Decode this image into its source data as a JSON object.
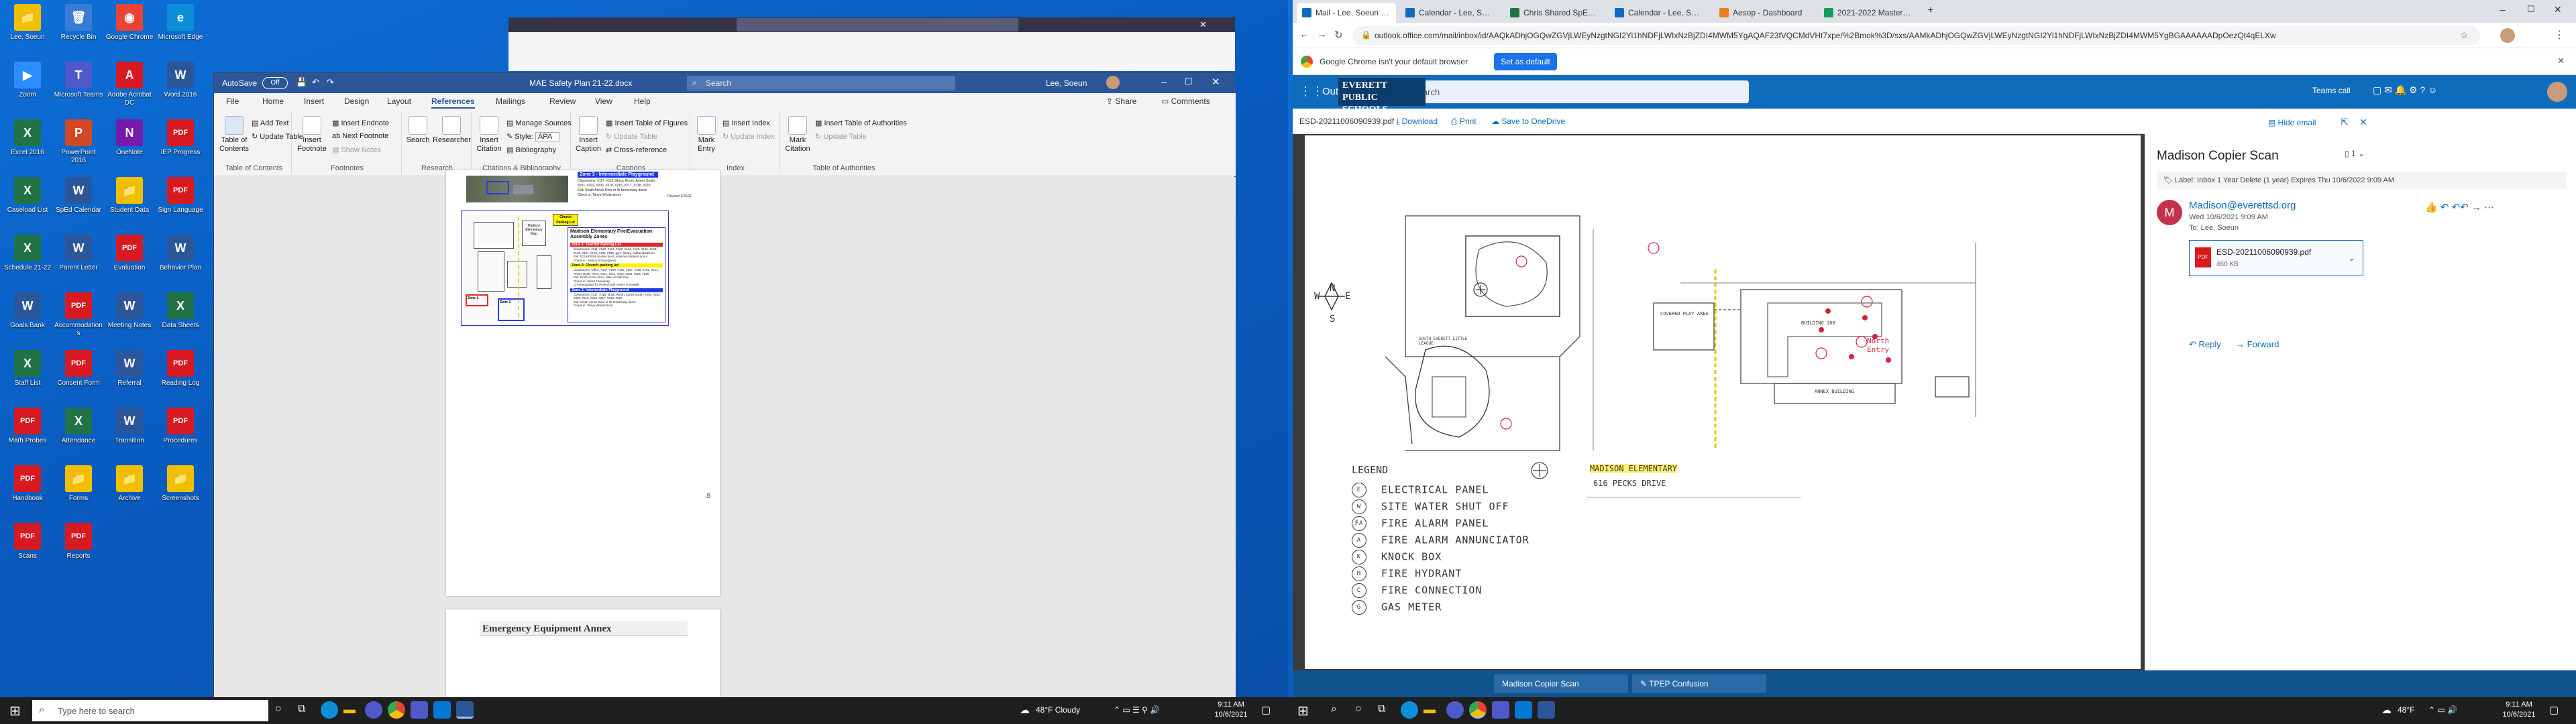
{
  "desktop_left": {
    "icons": [
      {
        "label": "Lee, Soeun",
        "color": "#f0c000",
        "glyph": "📁"
      },
      {
        "label": "Recycle Bin",
        "color": "#3a7bd5",
        "glyph": "🗑"
      },
      {
        "label": "Google Chrome",
        "color": "#ea4335",
        "glyph": "◉"
      },
      {
        "label": "Microsoft Edge",
        "color": "#0c8ed9",
        "glyph": "e"
      },
      {
        "label": "Zoom",
        "color": "#2d8cff",
        "glyph": "▶"
      },
      {
        "label": "Microsoft Teams",
        "color": "#5059c9",
        "glyph": "T"
      },
      {
        "label": "Adobe Acrobat DC",
        "color": "#d71920",
        "glyph": "A"
      },
      {
        "label": "Word 2016",
        "color": "#2b579a",
        "glyph": "W"
      },
      {
        "label": "Excel 2016",
        "color": "#217346",
        "glyph": "X"
      },
      {
        "label": "PowerPoint 2016",
        "color": "#d24726",
        "glyph": "P"
      },
      {
        "label": "OneNote",
        "color": "#7719aa",
        "glyph": "N"
      },
      {
        "label": "IEP Progress",
        "color": "#d71920",
        "glyph": "PDF"
      },
      {
        "label": "Caseload List",
        "color": "#217346",
        "glyph": "X"
      },
      {
        "label": "SpEd Calendar",
        "color": "#2b579a",
        "glyph": "W"
      },
      {
        "label": "Student Data",
        "color": "#f0c000",
        "glyph": "📁"
      },
      {
        "label": "Sign Language",
        "color": "#d71920",
        "glyph": "PDF"
      },
      {
        "label": "Schedule 21-22",
        "color": "#217346",
        "glyph": "X"
      },
      {
        "label": "Parent Letter",
        "color": "#2b579a",
        "glyph": "W"
      },
      {
        "label": "Evaluation",
        "color": "#d71920",
        "glyph": "PDF"
      },
      {
        "label": "Behavior Plan",
        "color": "#2b579a",
        "glyph": "W"
      },
      {
        "label": "Goals Bank",
        "color": "#2b579a",
        "glyph": "W"
      },
      {
        "label": "Accommodations",
        "color": "#d71920",
        "glyph": "PDF"
      },
      {
        "label": "Meeting Notes",
        "color": "#2b579a",
        "glyph": "W"
      },
      {
        "label": "Data Sheets",
        "color": "#217346",
        "glyph": "X"
      },
      {
        "label": "Staff List",
        "color": "#217346",
        "glyph": "X"
      },
      {
        "label": "Consent Form",
        "color": "#d71920",
        "glyph": "PDF"
      },
      {
        "label": "Referral",
        "color": "#2b579a",
        "glyph": "W"
      },
      {
        "label": "Reading Log",
        "color": "#d71920",
        "glyph": "PDF"
      },
      {
        "label": "Math Probes",
        "color": "#d71920",
        "glyph": "PDF"
      },
      {
        "label": "Attendance",
        "color": "#217346",
        "glyph": "X"
      },
      {
        "label": "Transition",
        "color": "#2b579a",
        "glyph": "W"
      },
      {
        "label": "Procedures",
        "color": "#d71920",
        "glyph": "PDF"
      },
      {
        "label": "Handbook",
        "color": "#d71920",
        "glyph": "PDF"
      },
      {
        "label": "Forms",
        "color": "#f0c000",
        "glyph": "📁"
      },
      {
        "label": "Archive",
        "color": "#f0c000",
        "glyph": "📁"
      },
      {
        "label": "Screenshots",
        "color": "#f0c000",
        "glyph": "📁"
      },
      {
        "label": "Scans",
        "color": "#d71920",
        "glyph": "PDF"
      },
      {
        "label": "Reports",
        "color": "#d71920",
        "glyph": "PDF"
      }
    ]
  },
  "word": {
    "autosave_label": "AutoSave",
    "autosave_state": "Off",
    "title": "MAE Safety Plan 21-22.docx",
    "search_placeholder": "Search",
    "user": "Lee, Soeun",
    "menu": [
      "File",
      "Home",
      "Insert",
      "Design",
      "Layout",
      "References",
      "Mailings",
      "Review",
      "View",
      "Help"
    ],
    "share_label": "Share",
    "comments_label": "Comments",
    "ribbon": {
      "toc_label": "Table of Contents",
      "add_text": "Add Text",
      "update_table": "Update Table",
      "group_toc": "Table of Contents",
      "insert_footnote": "Insert Footnote",
      "insert_endnote": "Insert Endnote",
      "next_footnote": "Next Footnote",
      "show_notes": "Show Notes",
      "group_footnotes": "Footnotes",
      "search": "Search",
      "researcher": "Researcher",
      "group_research": "Research",
      "insert_citation": "Insert Citation",
      "manage_sources": "Manage Sources",
      "style": "Style:",
      "style_value": "APA",
      "bibliography": "Bibliography",
      "group_citations": "Citations & Bibliography",
      "insert_caption": "Insert Caption",
      "insert_table_of_figures": "Insert Table of Figures",
      "update_table_dim": "Update Table",
      "cross_reference": "Cross-reference",
      "group_captions": "Captions",
      "mark_entry": "Mark Entry",
      "insert_index": "Insert Index",
      "update_index": "Update Index",
      "group_index": "Index",
      "mark_citation": "Mark Citation",
      "insert_toa": "Insert Table of Authorities",
      "update_table_toa": "Update Table",
      "group_toa": "Table of Authorities"
    },
    "doc": {
      "zone3_header": "Zone 3 - Intermediate Playground",
      "zone3_top_lines": [
        "Classrooms: #117, #118, Music Room, Annex South",
        "#201, #202, #203, #210, #216, #217, #218, #220",
        "Exit: South Annex Door or W breezeway doors",
        "Check in: Tanya Westerstrom"
      ],
      "revised": "Revised 2/26/21",
      "church_label": "Church Parking Lot",
      "madison_map_label": "Madison Elementary Map",
      "zone1_map": "Zone 1",
      "zone3_map": "Zone 3",
      "plan_title": "Madison Elementary Fire/Evacuation Assembly Zones",
      "z1_head": "Zone 1: Teacher Parking Lot",
      "z1_lines": [
        "Classrooms: #111, #120, #121, #122, #124, #125, #126, #128, #130, #131, #132, #135, #159, gym, library, cafeteria/kitchen",
        "Exit: ICEA/FIS/R double doors, external cafeteria doors",
        "Check in: Jessica Schug-Quiroz"
      ],
      "z2_head": "Zone 2: Church parking lot",
      "z2_lines": [
        "Classrooms: Office, #137, #150, #156, #157, #158, #162, #161, Annex North: #210, #211, #212, #222, #223, #224, #225",
        "Exit: North Annex Door, Main or NW door",
        "Check in: Sarah Farquasky",
        "Crossing guard for Pecks/Cady covers crosswalk"
      ],
      "z3_head": "Zone 3: Intermediate Playground",
      "z3_lines": [
        "Classrooms: #117, #118, Music Room, Annex South: #201, #202, #203, #210, #216, #217, #218, #220",
        "Exit: South Annex Door or W breezeway doors",
        "Check in: Tanya Westerstrom"
      ],
      "page_number": "8",
      "annex_title": "Emergency Equipment Annex"
    }
  },
  "taskbar_left": {
    "search_placeholder": "Type here to search",
    "weather": "48°F  Cloudy",
    "time": "9:11 AM",
    "date": "10/6/2021"
  },
  "chrome": {
    "tabs": [
      {
        "label": "Mail - Lee, Soeun - Outlook",
        "color": "#0f6cbd"
      },
      {
        "label": "Calendar - Lee, Soeun - Outlook",
        "color": "#0f6cbd"
      },
      {
        "label": "Chris Shared SpEd para schedule",
        "color": "#217346"
      },
      {
        "label": "Calendar - Lee, Soeun - Outlook",
        "color": "#0f6cbd"
      },
      {
        "label": "Aesop - Dashboard",
        "color": "#e67e22"
      },
      {
        "label": "2021-2022 Master Schedules - G",
        "color": "#0f9d58"
      }
    ],
    "url": "outlook.office.com/mail/inbox/id/AAQkADhjOGQwZGVjLWEyNzgtNGI2Yi1hNDFjLWIxNzBjZDI4MWM5YgAQAF23fVQCMdVHt7xpe/%2Bmok%3D/sxs/AAMkADhjOGQwZGVjLWEyNzgtNGI2Yi1hNDFjLWIxNzBjZDI4MWM5YgBGAAAAAADpOezQt4qELXw",
    "info_text": "Google Chrome isn't your default browser",
    "info_button": "Set as default"
  },
  "outlook": {
    "app_name": "Outlook",
    "search_placeholder": "Search",
    "teams_call": "Teams call",
    "brand": "EVERETT PUBLIC SCHOOLS",
    "file_name": "ESD-20211006090939.pdf",
    "download": "Download",
    "print": "Print",
    "save_onedrive": "Save to OneDrive",
    "hide_email": "Hide email",
    "subject": "Madison Copier Scan",
    "count": "1",
    "label_line": "Label: Inbox 1 Year Delete (1 year) Expires Thu 10/6/2022 9:09 AM",
    "sender": "Madison@everettsd.org",
    "sent": "Wed 10/6/2021 9:09 AM",
    "to_label": "To:",
    "to": "Lee, Soeun",
    "attachment_name": "ESD-20211006090939.pdf",
    "attachment_size": "460 KB",
    "reply": "Reply",
    "forward": "Forward",
    "bottom_items": [
      "Madison Copier Scan",
      "TPEP Confusion"
    ],
    "avatar_letter": "M"
  },
  "scan": {
    "compass_n": "N",
    "compass_s": "S",
    "compass_e": "E",
    "compass_w": "W",
    "legend_title": "LEGEND",
    "legend": [
      {
        "sym": "E",
        "label": "ELECTRICAL PANEL"
      },
      {
        "sym": "W",
        "label": "SITE WATER SHUT OFF"
      },
      {
        "sym": "FA",
        "label": "FIRE ALARM PANEL"
      },
      {
        "sym": "A",
        "label": "FIRE ALARM ANNUNCIATOR"
      },
      {
        "sym": "K",
        "label": "KNOCK BOX"
      },
      {
        "sym": "H",
        "label": "FIRE HYDRANT"
      },
      {
        "sym": "C",
        "label": "FIRE CONNECTION"
      },
      {
        "sym": "G",
        "label": "GAS METER"
      }
    ],
    "school_name": "MADISON ELEMENTARY",
    "address": "616 PECKS DRIVE",
    "covered_play": "COVERED PLAY AREA",
    "building": "BUILDING 100",
    "annex": "ANNEX BUILDING",
    "north_entry": "North Entry",
    "field_label": "SOUTH EVERETT LITTLE LEAGUE"
  },
  "taskbar_right": {
    "weather": "48°F",
    "time": "9:11 AM",
    "date": "10/6/2021"
  }
}
